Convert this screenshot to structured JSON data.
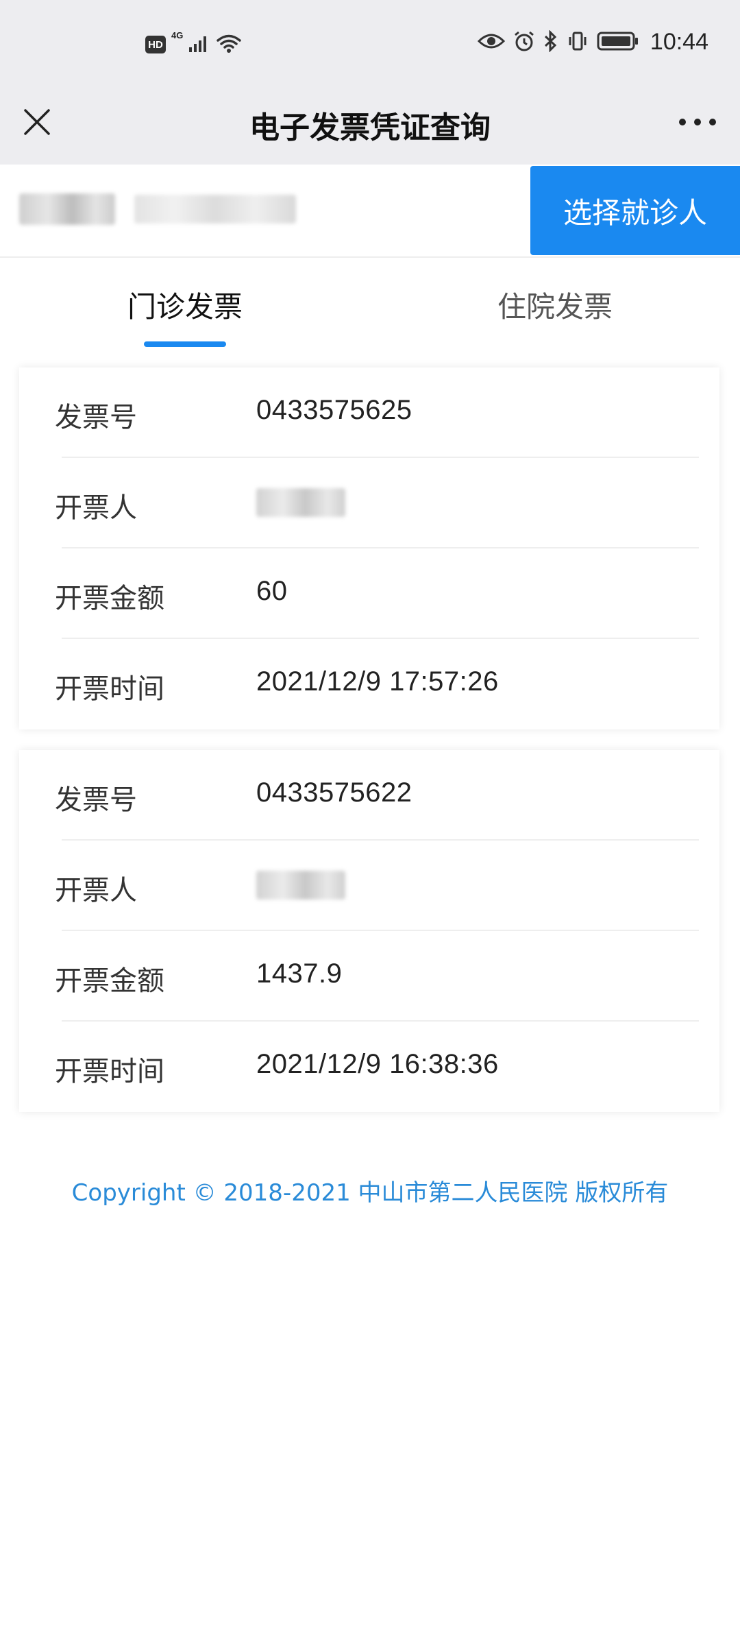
{
  "status_bar": {
    "hd": "HD",
    "network": "4G",
    "time": "10:44"
  },
  "nav": {
    "title": "电子发票凭证查询"
  },
  "patient": {
    "select_label": "选择就诊人"
  },
  "tabs": [
    {
      "label": "门诊发票",
      "active": true
    },
    {
      "label": "住院发票",
      "active": false
    }
  ],
  "invoices": [
    {
      "number_label": "发票号",
      "number": "0433575625",
      "issuer_label": "开票人",
      "amount_label": "开票金额",
      "amount": "60",
      "time_label": "开票时间",
      "time": "2021/12/9 17:57:26"
    },
    {
      "number_label": "发票号",
      "number": "0433575622",
      "issuer_label": "开票人",
      "amount_label": "开票金额",
      "amount": "1437.9",
      "time_label": "开票时间",
      "time": "2021/12/9 16:38:36"
    }
  ],
  "footer": {
    "copyright": "Copyright © 2018-2021 中山市第二人民医院 版权所有"
  },
  "colors": {
    "accent": "#1a89f0",
    "header_bg": "#ededf0",
    "footer_text": "#2a8bd8"
  },
  "icons": [
    "close-icon",
    "more-icon",
    "eye-icon",
    "alarm-icon",
    "bluetooth-icon",
    "vibrate-icon",
    "battery-icon",
    "signal-icon",
    "wifi-icon"
  ]
}
